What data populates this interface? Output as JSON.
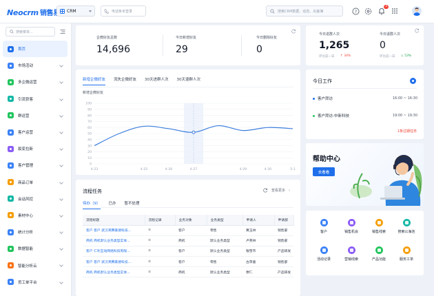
{
  "header": {
    "logo_en": "Neocrm",
    "logo_cn": "销售易",
    "app_select": "CRM",
    "phone_placeholder": "电话条未登录",
    "search_placeholder": "搜索CRM数据、动态、出差簿",
    "notifications_badge": "3"
  },
  "sidebar": {
    "search_placeholder": "搜索菜单...",
    "items": [
      {
        "label": "首页",
        "color": "#1f6feb",
        "active": true
      },
      {
        "label": "市场活动",
        "color": "#3b82f6"
      },
      {
        "label": "多企微运营",
        "color": "#22c55e"
      },
      {
        "label": "引流获客",
        "color": "#14b8a6"
      },
      {
        "label": "群运营",
        "color": "#22c55e"
      },
      {
        "label": "客户运营",
        "color": "#3b82f6"
      },
      {
        "label": "裂变拉新",
        "color": "#8b5cf6"
      },
      {
        "label": "客户管理",
        "color": "#3b82f6"
      },
      {
        "label": "商品订单",
        "color": "#f59e0b"
      },
      {
        "label": "会话风控",
        "color": "#14b8a6"
      },
      {
        "label": "素材中心",
        "color": "#f59e0b"
      },
      {
        "label": "统计分析",
        "color": "#3b82f6"
      },
      {
        "label": "数据智能",
        "color": "#22c55e"
      },
      {
        "label": "智能分析云",
        "color": "#f97316"
      },
      {
        "label": "员工单平台",
        "color": "#3b82f6"
      }
    ]
  },
  "kpi_main": {
    "items": [
      {
        "label": "企微好友总数",
        "value": "14,696"
      },
      {
        "label": "今日新增好友",
        "value": "29"
      },
      {
        "label": "今日删除好友",
        "value": "0"
      }
    ]
  },
  "kpi_side": {
    "items": [
      {
        "label": "今日进群人次",
        "value": "1,265",
        "compare_label": "环比前一日",
        "compare_value": "↑ 34%",
        "trend": "up"
      },
      {
        "label": "今日退群人次",
        "value": "0",
        "compare_label": "环比前一日",
        "compare_value": "↓ 53%",
        "trend": "down"
      }
    ]
  },
  "chart_panel": {
    "tabs": [
      "新增企微好友",
      "流失企微好友",
      "30天进群人次",
      "30天退群人次"
    ],
    "active_tab": 0
  },
  "chart_data": {
    "type": "line",
    "title": "新增企微好友",
    "xlabel": "",
    "ylabel": "",
    "categories": [
      "4-23",
      "4-24",
      "4-25",
      "4-26",
      "4-27",
      "4-28",
      "4-29",
      "4-30",
      "5-1"
    ],
    "values": [
      30,
      50,
      62,
      58,
      52,
      63,
      55,
      60,
      58
    ],
    "ylim": [
      0,
      100
    ],
    "yticks": [
      0,
      10,
      20,
      30,
      40,
      50,
      60,
      70,
      80,
      90,
      100
    ],
    "xtick_labels": [
      "4-23",
      "4-25",
      "4-26",
      "4-27",
      "4-29",
      "4-30",
      "5-1"
    ],
    "highlight_index": 4,
    "color": "#3b7ddd"
  },
  "work_today": {
    "title": "今日工作",
    "items": [
      {
        "label": "客户拜访",
        "time": "16:00 ~ 16:30",
        "color": "#1f6feb"
      },
      {
        "label": "客户拜访-中新科技",
        "time": "19:00 ~ 19:30",
        "color": "#22c55e"
      }
    ],
    "overdue": "1条过期任务"
  },
  "help": {
    "title": "帮助中心",
    "button": "去看看"
  },
  "flow_tasks": {
    "title": "流程任务",
    "more": "查看更多",
    "tabs": [
      "待办（9）",
      "已办",
      "暂不处理"
    ],
    "columns": [
      "流程标题",
      "流程记录",
      "业务对象",
      "业务类型",
      "申请人",
      "申请部"
    ],
    "rows": [
      [
        "客户 客户 武汉英腾美德科技...",
        "≡",
        "客户",
        "零售",
        "黄玉林",
        "销售部"
      ],
      [
        "商机 商机默认业务类型实体...",
        "≡",
        "商机",
        "默认业务类型",
        "卢英林",
        "销售部"
      ],
      [
        "客户 仁利互动网络科技有限...",
        "≡",
        "客户",
        "默认业务类型",
        "银雪市",
        "产品研发"
      ],
      [
        "客户 客户 武汉英腾美德科技...",
        "≡",
        "客户",
        "零售",
        "古萍童",
        "销售部"
      ],
      [
        "商机 商机默认业务类型实体...",
        "≡",
        "商机",
        "默认业务类型",
        "寮仁",
        "产品研发"
      ]
    ]
  },
  "quick_links": [
    {
      "label": "客户",
      "color": "#3b82f6"
    },
    {
      "label": "销售机会",
      "color": "#8b5cf6"
    },
    {
      "label": "销售线索",
      "color": "#f59e0b"
    },
    {
      "label": "搜索公海池",
      "color": "#14b8a6"
    },
    {
      "label": "活动记录",
      "color": "#3b82f6"
    },
    {
      "label": "营销线索",
      "color": "#8b5cf6"
    },
    {
      "label": "产品功能",
      "color": "#22c55e"
    },
    {
      "label": "服务工单",
      "color": "#f59e0b"
    }
  ]
}
